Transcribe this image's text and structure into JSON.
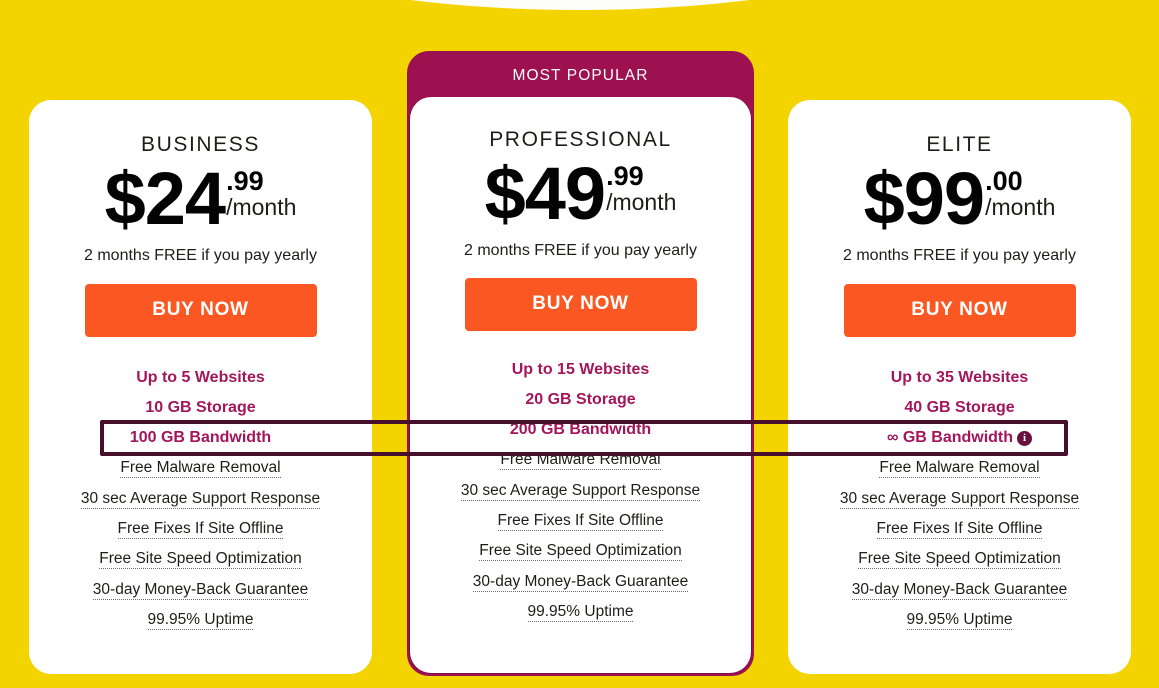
{
  "background": {
    "page_color": "#f4d400",
    "accent_maroon": "#9d1151",
    "accent_orange": "#fa5722",
    "highlight_border": "#46102c"
  },
  "plans": [
    {
      "id": "business",
      "name": "BUSINESS",
      "currency_amount": "$24",
      "cents": ".99",
      "period": "/month",
      "yearly_note": "2 months FREE if you pay yearly",
      "cta_label": "BUY NOW",
      "badge": null,
      "features": [
        {
          "text": "Up to 5 Websites",
          "style": "highlight"
        },
        {
          "text": "10 GB Storage",
          "style": "highlight"
        },
        {
          "text": "100 GB Bandwidth",
          "style": "highlight",
          "boxed": true
        },
        {
          "text": "Free Malware Removal",
          "style": "dotted"
        },
        {
          "text": "30 sec Average Support Response",
          "style": "dotted"
        },
        {
          "text": "Free Fixes If Site Offline",
          "style": "dotted"
        },
        {
          "text": "Free Site Speed Optimization",
          "style": "dotted"
        },
        {
          "text": "30-day Money-Back Guarantee",
          "style": "dotted"
        },
        {
          "text": "99.95% Uptime",
          "style": "dotted"
        }
      ]
    },
    {
      "id": "professional",
      "name": "PROFESSIONAL",
      "currency_amount": "$49",
      "cents": ".99",
      "period": "/month",
      "yearly_note": "2 months FREE if you pay yearly",
      "cta_label": "BUY NOW",
      "badge": "MOST POPULAR",
      "features": [
        {
          "text": "Up to 15 Websites",
          "style": "highlight"
        },
        {
          "text": "20 GB Storage",
          "style": "highlight"
        },
        {
          "text": "200 GB Bandwidth",
          "style": "highlight",
          "boxed": true
        },
        {
          "text": "Free Malware Removal",
          "style": "dotted"
        },
        {
          "text": "30 sec Average Support Response",
          "style": "dotted"
        },
        {
          "text": "Free Fixes If Site Offline",
          "style": "dotted"
        },
        {
          "text": "Free Site Speed Optimization",
          "style": "dotted"
        },
        {
          "text": "30-day Money-Back Guarantee",
          "style": "dotted"
        },
        {
          "text": "99.95% Uptime",
          "style": "dotted"
        }
      ]
    },
    {
      "id": "elite",
      "name": "ELITE",
      "currency_amount": "$99",
      "cents": ".00",
      "period": "/month",
      "yearly_note": "2 months FREE if you pay yearly",
      "cta_label": "BUY NOW",
      "badge": null,
      "features": [
        {
          "text": "Up to 35 Websites",
          "style": "highlight"
        },
        {
          "text": "40 GB Storage",
          "style": "highlight"
        },
        {
          "text": "∞ GB Bandwidth",
          "style": "highlight",
          "boxed": true,
          "info_icon": "i"
        },
        {
          "text": "Free Malware Removal",
          "style": "dotted"
        },
        {
          "text": "30 sec Average Support Response",
          "style": "dotted"
        },
        {
          "text": "Free Fixes If Site Offline",
          "style": "dotted"
        },
        {
          "text": "Free Site Speed Optimization",
          "style": "dotted"
        },
        {
          "text": "30-day Money-Back Guarantee",
          "style": "dotted"
        },
        {
          "text": "99.95% Uptime",
          "style": "dotted"
        }
      ]
    }
  ]
}
